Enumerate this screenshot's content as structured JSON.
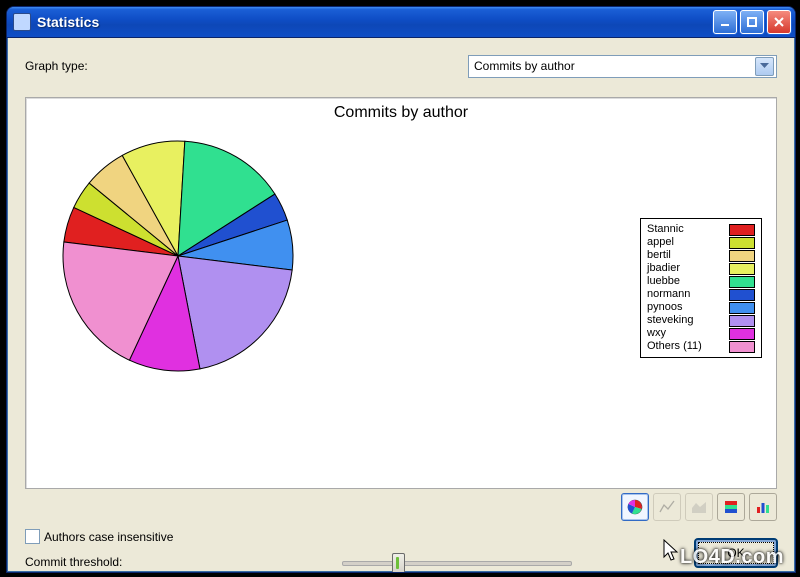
{
  "window": {
    "title": "Statistics"
  },
  "controls": {
    "graph_type_label": "Graph type:",
    "graph_type_value": "Commits by author",
    "authors_case_label": "Authors case insensitive",
    "authors_case_checked": false,
    "commit_threshold_label": "Commit threshold:",
    "ok_label": "OK"
  },
  "legend": [
    {
      "name": "Stannic",
      "color": "#e02020"
    },
    {
      "name": "appel",
      "color": "#cde030"
    },
    {
      "name": "bertil",
      "color": "#f0d480"
    },
    {
      "name": "jbadier",
      "color": "#e8f060"
    },
    {
      "name": "luebbe",
      "color": "#30e090"
    },
    {
      "name": "normann",
      "color": "#2050d0"
    },
    {
      "name": "pynoos",
      "color": "#4090f0"
    },
    {
      "name": "steveking",
      "color": "#b090f0"
    },
    {
      "name": "wxy",
      "color": "#e030e0"
    },
    {
      "name": "Others (11)",
      "color": "#f090d0"
    }
  ],
  "chart_data": {
    "type": "pie",
    "title": "Commits by author",
    "series": [
      {
        "name": "Stannic",
        "value": 5,
        "color": "#e02020"
      },
      {
        "name": "appel",
        "value": 4,
        "color": "#cde030"
      },
      {
        "name": "bertil",
        "value": 6,
        "color": "#f0d480"
      },
      {
        "name": "jbadier",
        "value": 9,
        "color": "#e8f060"
      },
      {
        "name": "luebbe",
        "value": 15,
        "color": "#30e090"
      },
      {
        "name": "normann",
        "value": 4,
        "color": "#2050d0"
      },
      {
        "name": "pynoos",
        "value": 7,
        "color": "#4090f0"
      },
      {
        "name": "steveking",
        "value": 20,
        "color": "#b090f0"
      },
      {
        "name": "wxy",
        "value": 10,
        "color": "#e030e0"
      },
      {
        "name": "Others (11)",
        "value": 20,
        "color": "#f090d0"
      }
    ]
  },
  "watermark": "LO4D.com"
}
